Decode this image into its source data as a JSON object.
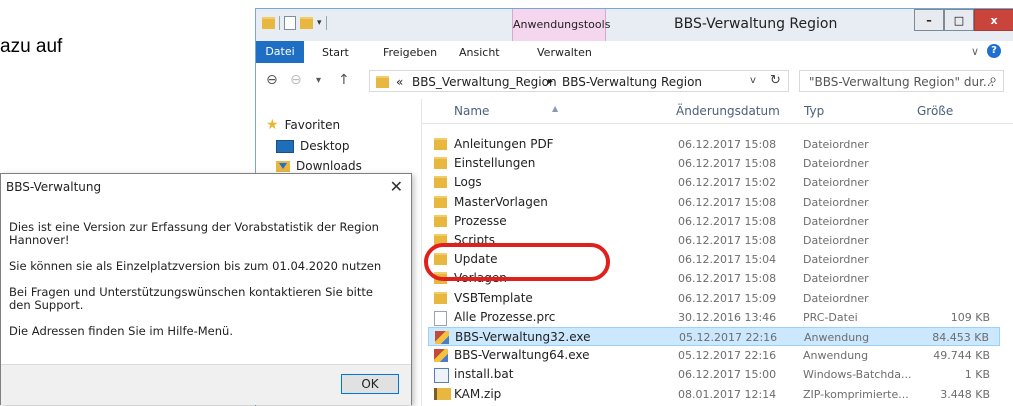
{
  "background_text": "azu auf",
  "explorer": {
    "title": "BBS-Verwaltung Region",
    "context_tab": "Anwendungstools",
    "window_buttons": {
      "minimize": "–",
      "maximize": "□",
      "close": "x"
    },
    "ribbon_tabs": [
      "Datei",
      "Start",
      "Freigeben",
      "Ansicht",
      "Verwalten"
    ],
    "nav": {
      "back": "⊖",
      "forward": "⊖",
      "dropdown": "▾",
      "up": "↑"
    },
    "address": {
      "prefix": "«",
      "crumbs": [
        "BBS_Verwaltung_Region",
        "▸",
        "BBS-Verwaltung Region"
      ],
      "dropdown": "v",
      "refresh": "↻"
    },
    "search_placeholder": "\"BBS-Verwaltung Region\" dur...",
    "nav_pane": [
      {
        "label": "Favoriten",
        "icon": "star-icon"
      },
      {
        "label": "Desktop",
        "icon": "desktop-icon"
      },
      {
        "label": "Downloads",
        "icon": "downloads-icon"
      }
    ],
    "columns": [
      "Name",
      "Änderungsdatum",
      "Typ",
      "Größe"
    ],
    "files": [
      {
        "name": "Anleitungen PDF",
        "date": "06.12.2017 15:08",
        "type": "Dateiordner",
        "size": "",
        "icon": "folder"
      },
      {
        "name": "Einstellungen",
        "date": "06.12.2017 15:08",
        "type": "Dateiordner",
        "size": "",
        "icon": "folder"
      },
      {
        "name": "Logs",
        "date": "06.12.2017 15:02",
        "type": "Dateiordner",
        "size": "",
        "icon": "folder"
      },
      {
        "name": "MasterVorlagen",
        "date": "06.12.2017 15:08",
        "type": "Dateiordner",
        "size": "",
        "icon": "folder"
      },
      {
        "name": "Prozesse",
        "date": "06.12.2017 15:08",
        "type": "Dateiordner",
        "size": "",
        "icon": "folder"
      },
      {
        "name": "Scripts",
        "date": "06.12.2017 15:08",
        "type": "Dateiordner",
        "size": "",
        "icon": "folder"
      },
      {
        "name": "Update",
        "date": "06.12.2017 15:04",
        "type": "Dateiordner",
        "size": "",
        "icon": "folder"
      },
      {
        "name": "Vorlagen",
        "date": "06.12.2017 15:08",
        "type": "Dateiordner",
        "size": "",
        "icon": "folder"
      },
      {
        "name": "VSBTemplate",
        "date": "06.12.2017 15:09",
        "type": "Dateiordner",
        "size": "",
        "icon": "folder"
      },
      {
        "name": "Alle Prozesse.prc",
        "date": "30.12.2016 13:46",
        "type": "PRC-Datei",
        "size": "109 KB",
        "icon": "file"
      },
      {
        "name": "BBS-Verwaltung32.exe",
        "date": "05.12.2017 22:16",
        "type": "Anwendung",
        "size": "84.453 KB",
        "icon": "exe",
        "selected": true
      },
      {
        "name": "BBS-Verwaltung64.exe",
        "date": "05.12.2017 22:16",
        "type": "Anwendung",
        "size": "49.744 KB",
        "icon": "exe"
      },
      {
        "name": "install.bat",
        "date": "06.12.2017 15:00",
        "type": "Windows-Batchda...",
        "size": "1 KB",
        "icon": "bat"
      },
      {
        "name": "KAM.zip",
        "date": "08.01.2017 12:14",
        "type": "ZIP-komprimierte...",
        "size": "3.448 KB",
        "icon": "zip"
      }
    ]
  },
  "dialog": {
    "title": "BBS-Verwaltung",
    "close": "✕",
    "paragraphs": [
      "Dies ist eine Version zur Erfassung der Vorabstatistik der Region Hannover!",
      "Sie können sie als Einzelplatzversion bis zum 01.04.2020 nutzen",
      "Bei Fragen und Unterstützungswünschen kontaktieren Sie bitte den Support.",
      "Die Adressen finden Sie im Hilfe-Menü."
    ],
    "ok_label": "OK"
  },
  "colors": {
    "accent": "#1e6fc4",
    "selection": "#cce8ff",
    "highlight_ring": "#e0201c",
    "context_tab": "#f4d6ee"
  }
}
